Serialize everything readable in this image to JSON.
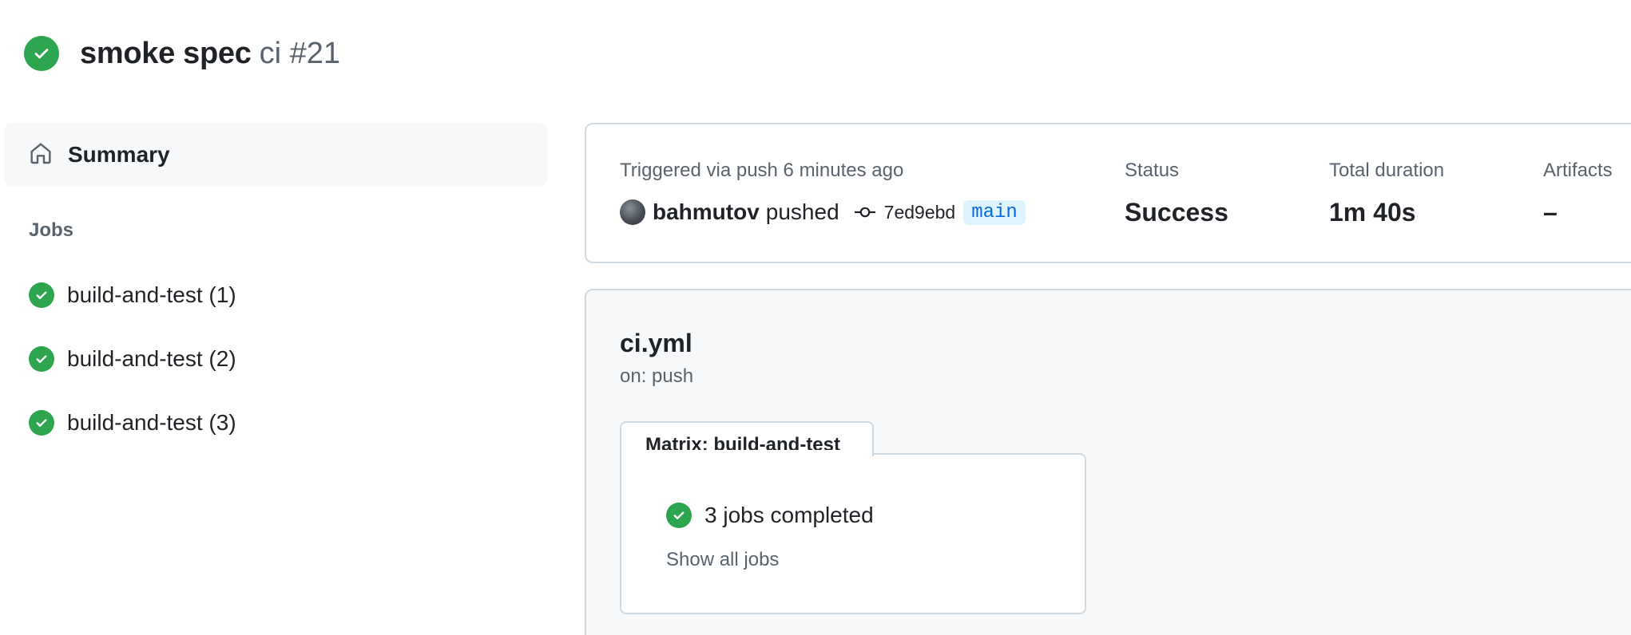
{
  "header": {
    "title": "smoke spec",
    "subtitle": "ci #21",
    "status_icon": "check-circle-fill-icon",
    "status_color": "#2da44e"
  },
  "sidebar": {
    "summary_label": "Summary",
    "summary_icon": "home-icon",
    "jobs_heading": "Jobs",
    "jobs": [
      {
        "label": "build-and-test (1)",
        "status": "success"
      },
      {
        "label": "build-and-test (2)",
        "status": "success"
      },
      {
        "label": "build-and-test (3)",
        "status": "success"
      }
    ]
  },
  "run_info": {
    "triggered": "Triggered via push 6 minutes ago",
    "user": "bahmutov",
    "action": "pushed",
    "commit_sha": "7ed9ebd",
    "branch": "main",
    "status_label": "Status",
    "status_value": "Success",
    "duration_label": "Total duration",
    "duration_value": "1m 40s",
    "artifacts_label": "Artifacts",
    "artifacts_value": "–"
  },
  "workflow": {
    "file": "ci.yml",
    "trigger": "on: push",
    "matrix_title": "Matrix: build-and-test",
    "completed_text": "3 jobs completed",
    "show_all": "Show all jobs"
  },
  "colors": {
    "success": "#2da44e",
    "branch_bg": "#ddf4ff",
    "branch_fg": "#0969da",
    "muted": "#59636e",
    "border": "#d1d9e0"
  }
}
